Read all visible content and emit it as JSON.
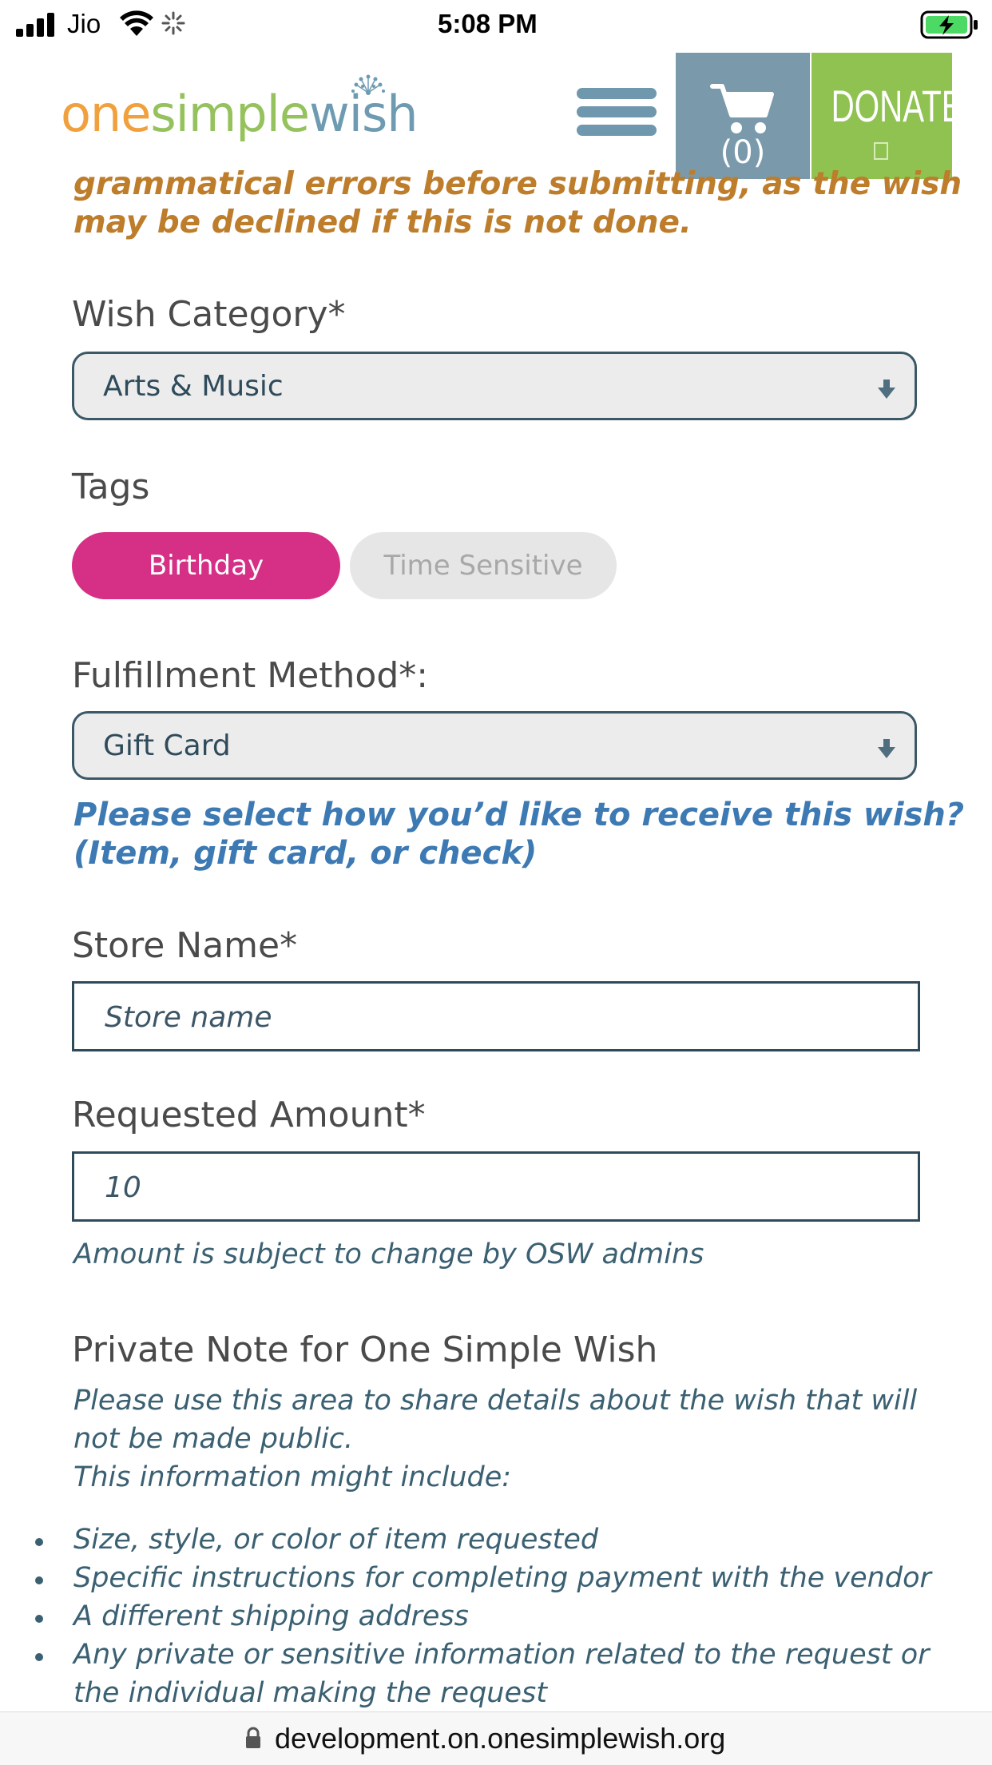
{
  "status_bar": {
    "carrier": "Jio",
    "time": "5:08 PM"
  },
  "header": {
    "logo": {
      "one": "one",
      "simple": "simple",
      "wish": "wish"
    },
    "cart_count": "(0)",
    "donate_label": "DONATE"
  },
  "form": {
    "intro_note_line1": "grammatical errors before submitting, as the wish",
    "intro_note_line2": "may be declined if this is not done.",
    "wish_category": {
      "label": "Wish Category*",
      "value": "Arts & Music"
    },
    "tags": {
      "label": "Tags",
      "items": [
        {
          "label": "Birthday",
          "selected": true
        },
        {
          "label": "Time Sensitive",
          "selected": false
        }
      ]
    },
    "fulfillment": {
      "label": "Fulfillment Method*:",
      "value": "Gift Card",
      "help_line1": "Please select how you’d like to receive this wish?",
      "help_line2": "(Item, gift card, or check)"
    },
    "store_name": {
      "label": "Store Name*",
      "placeholder": "Store name"
    },
    "requested_amount": {
      "label": "Requested Amount*",
      "value": "10",
      "note": "Amount is subject to change by OSW admins"
    },
    "private_note": {
      "title": "Private Note for One Simple Wish",
      "desc_line1": "Please use this area to share details about the wish that will",
      "desc_line2": "not be made public.",
      "desc_line3": "This information might include:",
      "bullets": [
        "Size, style, or color of item requested",
        "Specific instructions for completing payment with the vendor",
        "A different shipping address",
        "Any private or sensitive information related to the request or",
        "the individual making the request"
      ]
    }
  },
  "url_bar": {
    "url": "development.on.onesimplewish.org"
  },
  "colors": {
    "brand_orange": "#f0a03c",
    "brand_green": "#8fc251",
    "brand_blue": "#6f9bb2",
    "tag_selected": "#d52f86",
    "help_blue": "#3d7ab3"
  }
}
